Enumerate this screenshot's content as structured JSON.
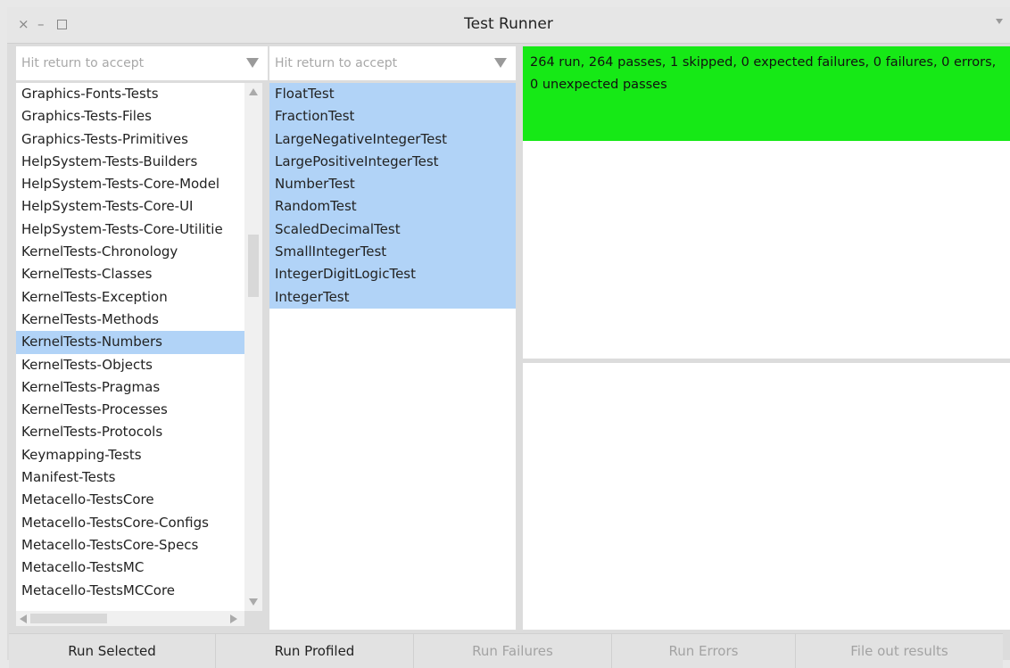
{
  "window": {
    "title": "Test Runner",
    "close_glyph": "×",
    "min_glyph": "–"
  },
  "packages": {
    "filter_placeholder": "Hit return to accept",
    "items": [
      "Graphics-Fonts-Tests",
      "Graphics-Tests-Files",
      "Graphics-Tests-Primitives",
      "HelpSystem-Tests-Builders",
      "HelpSystem-Tests-Core-Model",
      "HelpSystem-Tests-Core-UI",
      "HelpSystem-Tests-Core-Utilitie",
      "KernelTests-Chronology",
      "KernelTests-Classes",
      "KernelTests-Exception",
      "KernelTests-Methods",
      "KernelTests-Numbers",
      "KernelTests-Objects",
      "KernelTests-Pragmas",
      "KernelTests-Processes",
      "KernelTests-Protocols",
      "Keymapping-Tests",
      "Manifest-Tests",
      "Metacello-TestsCore",
      "Metacello-TestsCore-Configs",
      "Metacello-TestsCore-Specs",
      "Metacello-TestsMC",
      "Metacello-TestsMCCore"
    ],
    "selected": "KernelTests-Numbers"
  },
  "classes": {
    "filter_placeholder": "Hit return to accept",
    "items": [
      "FloatTest",
      "FractionTest",
      "LargeNegativeIntegerTest",
      "LargePositiveIntegerTest",
      "NumberTest",
      "RandomTest",
      "ScaledDecimalTest",
      "SmallIntegerTest",
      "IntegerDigitLogicTest",
      "IntegerTest"
    ],
    "all_selected": true
  },
  "result": {
    "text": "264 run, 264 passes, 1 skipped, 0 expected failures, 0 failures, 0 errors, 0 unexpected passes",
    "status_color": "#16e916"
  },
  "buttons": [
    {
      "label": "Run Selected",
      "enabled": true
    },
    {
      "label": "Run Profiled",
      "enabled": true
    },
    {
      "label": "Run Failures",
      "enabled": false
    },
    {
      "label": "Run Errors",
      "enabled": false
    },
    {
      "label": "File out results",
      "enabled": false
    }
  ],
  "colors": {
    "selection": "#b1d3f7",
    "pass": "#16e916",
    "disabled_text": "#a3a3a3"
  }
}
